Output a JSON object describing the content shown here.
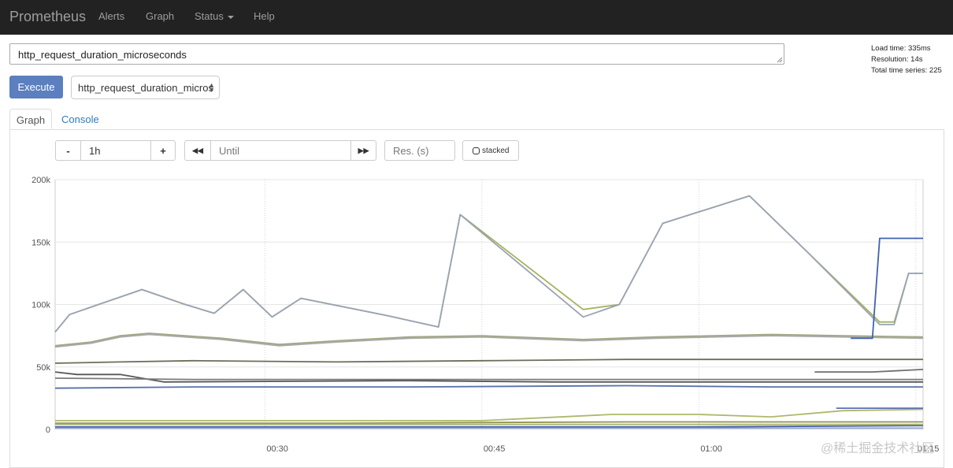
{
  "navbar": {
    "brand": "Prometheus",
    "items": [
      "Alerts",
      "Graph",
      "Status",
      "Help"
    ]
  },
  "query": {
    "expression": "http_request_duration_microseconds",
    "execute_label": "Execute",
    "metric_selected": "http_request_duration_micros"
  },
  "stats": {
    "load_time": "Load time: 335ms",
    "resolution": "Resolution: 14s",
    "total_series": "Total time series: 225"
  },
  "tabs": {
    "graph": "Graph",
    "console": "Console"
  },
  "controls": {
    "minus": "-",
    "range": "1h",
    "plus": "+",
    "back": "◀◀",
    "until_placeholder": "Until",
    "forward": "▶▶",
    "res_placeholder": "Res. (s)",
    "stacked_label": "stacked",
    "stacked_checked": false
  },
  "watermark": "@稀土掘金技术社区",
  "chart_data": {
    "type": "line",
    "ylim": [
      0,
      200000
    ],
    "y_ticks": [
      0,
      50000,
      100000,
      150000,
      200000
    ],
    "y_tick_labels": [
      "0",
      "50k",
      "100k",
      "150k",
      "200k"
    ],
    "x_start": "00:15:30",
    "x_end": "01:15:30",
    "x_ticks": [
      "00:30",
      "00:45",
      "01:00",
      "01:15"
    ],
    "grid": true,
    "series": [
      {
        "color": "#a5b35e",
        "points": [
          [
            "00:15:30",
            78000
          ],
          [
            "00:16:30",
            92000
          ],
          [
            "00:18:30",
            100000
          ],
          [
            "00:21:30",
            112000
          ],
          [
            "00:24:30",
            100000
          ],
          [
            "00:26:30",
            93000
          ],
          [
            "00:28:30",
            112000
          ],
          [
            "00:30:30",
            90000
          ],
          [
            "00:32:30",
            105000
          ],
          [
            "00:38:30",
            91000
          ],
          [
            "00:42:00",
            82000
          ],
          [
            "00:43:30",
            172000
          ],
          [
            "00:52:00",
            96000
          ],
          [
            "00:54:30",
            100000
          ],
          [
            "00:57:30",
            165000
          ],
          [
            "01:03:30",
            187000
          ],
          [
            "01:07:30",
            142000
          ],
          [
            "01:12:30",
            86000
          ],
          [
            "01:13:30",
            86000
          ],
          [
            "01:14:30",
            125000
          ],
          [
            "01:15:30",
            125000
          ]
        ]
      },
      {
        "color": "#9aa3b5",
        "points": [
          [
            "00:15:30",
            78000
          ],
          [
            "00:16:30",
            92000
          ],
          [
            "00:18:30",
            100000
          ],
          [
            "00:21:30",
            112000
          ],
          [
            "00:24:30",
            100000
          ],
          [
            "00:26:30",
            93000
          ],
          [
            "00:28:30",
            112000
          ],
          [
            "00:30:30",
            90000
          ],
          [
            "00:32:30",
            105000
          ],
          [
            "00:38:30",
            91000
          ],
          [
            "00:42:00",
            82000
          ],
          [
            "00:43:30",
            172000
          ],
          [
            "00:52:00",
            90000
          ],
          [
            "00:54:30",
            100000
          ],
          [
            "00:57:30",
            165000
          ],
          [
            "01:03:30",
            187000
          ],
          [
            "01:07:30",
            142000
          ],
          [
            "01:12:30",
            84000
          ],
          [
            "01:13:30",
            84000
          ],
          [
            "01:14:30",
            125000
          ],
          [
            "01:15:30",
            125000
          ]
        ]
      },
      {
        "color": "#9ea882",
        "points": [
          [
            "00:15:30",
            67000
          ],
          [
            "00:18:00",
            70000
          ],
          [
            "00:20:00",
            75000
          ],
          [
            "00:22:00",
            77000
          ],
          [
            "00:27:00",
            73000
          ],
          [
            "00:31:00",
            68000
          ],
          [
            "00:35:00",
            71000
          ],
          [
            "00:40:00",
            74000
          ],
          [
            "00:45:00",
            75000
          ],
          [
            "00:52:00",
            72000
          ],
          [
            "00:57:00",
            74000
          ],
          [
            "01:05:00",
            76000
          ],
          [
            "01:10:00",
            75000
          ],
          [
            "01:15:30",
            74000
          ]
        ]
      },
      {
        "color": "#a9a9a9",
        "points": [
          [
            "00:15:30",
            66000
          ],
          [
            "00:18:00",
            69000
          ],
          [
            "00:20:00",
            74000
          ],
          [
            "00:22:00",
            76000
          ],
          [
            "00:27:00",
            72000
          ],
          [
            "00:31:00",
            67000
          ],
          [
            "00:35:00",
            70000
          ],
          [
            "00:40:00",
            73000
          ],
          [
            "00:45:00",
            74000
          ],
          [
            "00:52:00",
            71000
          ],
          [
            "00:57:00",
            73000
          ],
          [
            "01:05:00",
            75000
          ],
          [
            "01:10:00",
            74000
          ],
          [
            "01:15:30",
            73000
          ]
        ]
      },
      {
        "color": "#6d6d5a",
        "points": [
          [
            "00:15:30",
            53000
          ],
          [
            "00:20:00",
            54000
          ],
          [
            "00:25:00",
            55000
          ],
          [
            "00:35:00",
            54000
          ],
          [
            "00:45:00",
            55000
          ],
          [
            "00:55:00",
            56000
          ],
          [
            "01:05:00",
            56000
          ],
          [
            "01:15:30",
            56000
          ]
        ]
      },
      {
        "color": "#585858",
        "points": [
          [
            "00:15:30",
            46000
          ],
          [
            "00:17:00",
            44000
          ],
          [
            "00:20:00",
            44000
          ],
          [
            "00:23:00",
            38000
          ],
          [
            "00:40:00",
            39000
          ],
          [
            "00:50:00",
            38000
          ],
          [
            "01:00:00",
            38000
          ],
          [
            "01:10:00",
            38000
          ],
          [
            "01:15:30",
            38000
          ]
        ]
      },
      {
        "color": "#7a7a7a",
        "points": [
          [
            "00:15:30",
            41000
          ],
          [
            "00:25:00",
            40000
          ],
          [
            "00:40:00",
            40000
          ],
          [
            "00:55:00",
            40000
          ],
          [
            "01:10:00",
            40000
          ],
          [
            "01:15:30",
            40000
          ]
        ]
      },
      {
        "color": "#5872a8",
        "points": [
          [
            "00:15:30",
            33000
          ],
          [
            "00:25:00",
            34000
          ],
          [
            "00:40:00",
            34000
          ],
          [
            "00:55:00",
            35000
          ],
          [
            "01:05:00",
            34000
          ],
          [
            "01:15:30",
            34000
          ]
        ]
      },
      {
        "color": "#3f63b0",
        "points": [
          [
            "01:10:30",
            73000
          ],
          [
            "01:12:00",
            73000
          ],
          [
            "01:12:30",
            153000
          ],
          [
            "01:15:30",
            153000
          ]
        ]
      },
      {
        "color": "#6f6f6f",
        "points": [
          [
            "01:08:00",
            46000
          ],
          [
            "01:12:00",
            46000
          ],
          [
            "01:15:30",
            48000
          ]
        ]
      },
      {
        "color": "#b0b86a",
        "points": [
          [
            "00:15:30",
            7000
          ],
          [
            "00:30:00",
            7000
          ],
          [
            "00:45:00",
            7000
          ],
          [
            "00:54:00",
            12000
          ],
          [
            "01:00:00",
            12000
          ],
          [
            "01:05:00",
            10000
          ],
          [
            "01:10:00",
            15000
          ],
          [
            "01:15:30",
            16000
          ]
        ]
      },
      {
        "color": "#8f9550",
        "points": [
          [
            "00:15:30",
            5000
          ],
          [
            "00:35:00",
            5000
          ],
          [
            "00:55:00",
            6000
          ],
          [
            "01:15:30",
            6000
          ]
        ]
      },
      {
        "color": "#4a62a8",
        "points": [
          [
            "00:15:30",
            2000
          ],
          [
            "00:40:00",
            2000
          ],
          [
            "01:00:00",
            2000
          ],
          [
            "01:15:30",
            3000
          ]
        ]
      },
      {
        "color": "#8ea1c5",
        "points": [
          [
            "00:15:30",
            1000
          ],
          [
            "00:40:00",
            1000
          ],
          [
            "01:15:30",
            1000
          ]
        ]
      },
      {
        "color": "#adb573",
        "points": [
          [
            "00:15:30",
            4000
          ],
          [
            "00:45:00",
            4000
          ],
          [
            "01:15:30",
            4000
          ]
        ]
      },
      {
        "color": "#5b6fb5",
        "points": [
          [
            "01:09:30",
            17000
          ],
          [
            "01:15:30",
            17000
          ]
        ]
      }
    ]
  }
}
